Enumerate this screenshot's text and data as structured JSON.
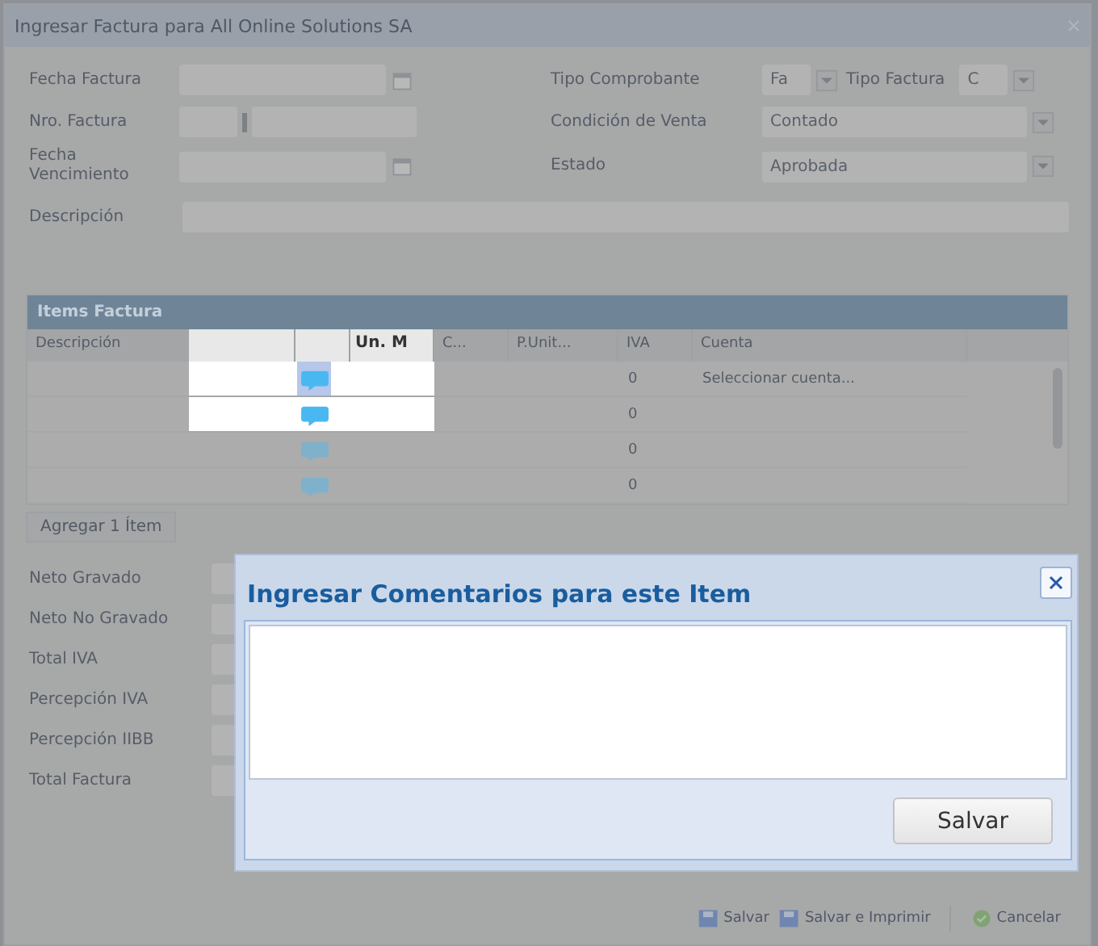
{
  "window": {
    "title": "Ingresar Factura para All Online Solutions SA"
  },
  "form": {
    "left": [
      {
        "label": "Fecha Factura",
        "kind": "date"
      },
      {
        "label": "Nro. Factura",
        "kind": "number"
      },
      {
        "label": "Fecha Vencimiento",
        "kind": "date"
      }
    ],
    "right": [
      {
        "label": "Tipo Comprobante",
        "kind": "double",
        "value": "Fa",
        "second_label": "Tipo Factura",
        "second_value": "C"
      },
      {
        "label": "Condición de Venta",
        "kind": "select",
        "value": "Contado"
      },
      {
        "label": "Estado",
        "kind": "select",
        "value": "Aprobada"
      }
    ],
    "description": {
      "label": "Descripción"
    }
  },
  "items": {
    "title": "Items Factura",
    "columns": [
      {
        "label": "Descripción",
        "kind": "text"
      },
      {
        "kind": "icon"
      },
      {
        "label": "Un. M",
        "kind": "text"
      },
      {
        "label": "C...",
        "kind": "text"
      },
      {
        "label": "P.Unit...",
        "kind": "text"
      },
      {
        "label": "IVA",
        "kind": "text"
      },
      {
        "label": "Cuenta",
        "kind": "text"
      }
    ],
    "rows": [
      {
        "iva": "0",
        "cuenta": "Seleccionar cuenta...",
        "selected": true
      },
      {
        "iva": "0",
        "selected": false
      },
      {
        "iva": "0",
        "selected": false
      },
      {
        "iva": "0",
        "selected": false
      }
    ]
  },
  "add_button": "Agregar 1 Ítem",
  "totals": [
    "Neto Gravado",
    "Neto No Gravado",
    "Total IVA",
    "Percepción IVA",
    "Percepción IIBB",
    "Total Factura"
  ],
  "footer_buttons": [
    {
      "label": "Salvar",
      "kind": "save"
    },
    {
      "label": "Salvar e Imprimir",
      "kind": "save"
    },
    {
      "label": "Cancelar",
      "kind": "cancel"
    }
  ],
  "dialog": {
    "title": "Ingresar Comentarios para este Item",
    "button": "Salvar"
  }
}
